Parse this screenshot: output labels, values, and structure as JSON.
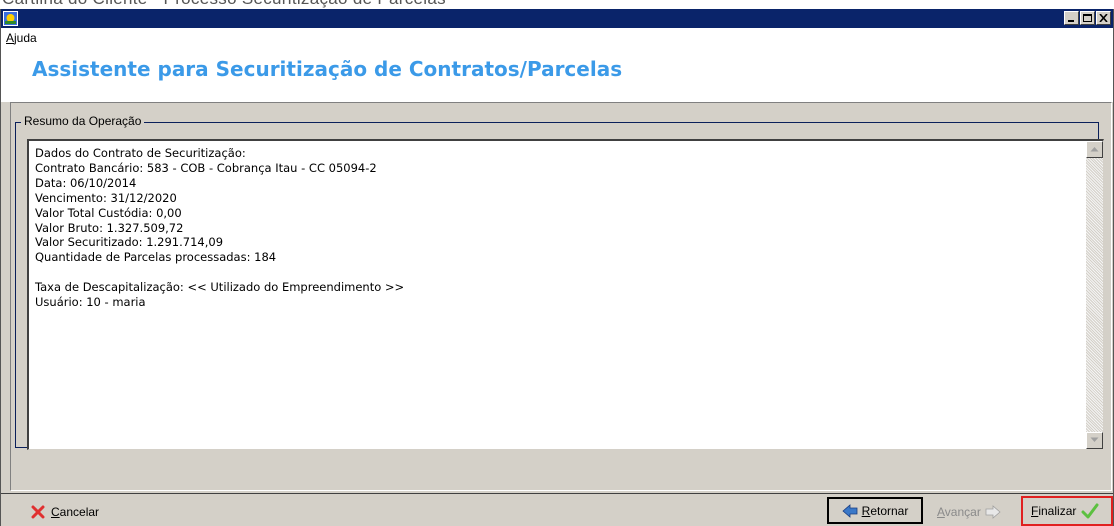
{
  "caption": "Cartilha do Cliente - Processo Securitização de Parcelas",
  "window": {
    "icon": "app-icon",
    "controls": [
      "minimize-icon",
      "maximize-icon",
      "close-icon"
    ]
  },
  "menu": {
    "help": "Ajuda"
  },
  "header": {
    "title": "Assistente para Securitização de Contratos/Parcelas"
  },
  "summary": {
    "legend": "Resumo da Operação",
    "lines": [
      "Dados do Contrato de Securitização:",
      "Contrato Bancário: 583 - COB - Cobrança Itau - CC 05094-2",
      "Data: 06/10/2014",
      "Vencimento: 31/12/2020",
      "Valor Total Custódia: 0,00",
      "Valor Bruto: 1.327.509,72",
      "Valor Securitizado: 1.291.714,09",
      "Quantidade de Parcelas processadas: 184",
      "",
      "Taxa de Descapitalização: << Utilizado do Empreendimento >>",
      "Usuário: 10 - maria"
    ]
  },
  "footer": {
    "cancel": "Cancelar",
    "back": "Retornar",
    "next": "Avançar",
    "finish": "Finalizar"
  },
  "colors": {
    "title_bar": "#0a246a",
    "header_text": "#3b9ae8",
    "cancel_icon": "#e03030",
    "finish_icon": "#5cc040",
    "highlight": "#e02020"
  }
}
